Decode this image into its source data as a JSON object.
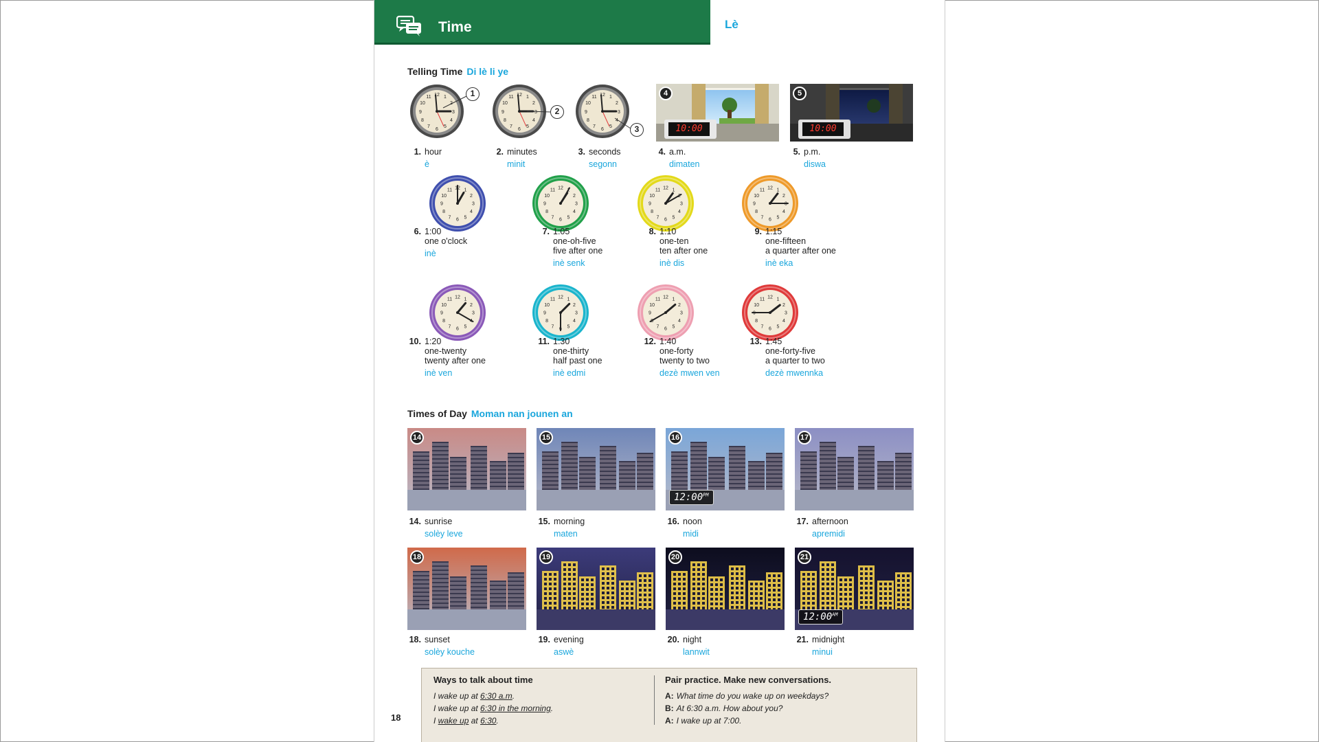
{
  "header": {
    "title": "Time",
    "translation": "Lè"
  },
  "telling_time": {
    "title": "Telling Time",
    "title_tr": "Di lè li ye",
    "items": [
      {
        "num": "1.",
        "en": "hour",
        "tr": "è"
      },
      {
        "num": "2.",
        "en": "minutes",
        "tr": "minit"
      },
      {
        "num": "3.",
        "en": "seconds",
        "tr": "segonn"
      },
      {
        "num": "4.",
        "en": "a.m.",
        "tr": "dimaten"
      },
      {
        "num": "5.",
        "en": "p.m.",
        "tr": "diswa"
      }
    ],
    "callouts": [
      "1",
      "2",
      "3",
      "4",
      "5"
    ],
    "digital": [
      "10:00",
      "10:00"
    ],
    "clocks": [
      {
        "num": "6.",
        "time": "1:00",
        "l1": "one o'clock",
        "l2": "",
        "tr": "inè",
        "color": "#3f4fae"
      },
      {
        "num": "7.",
        "time": "1:05",
        "l1": "one-oh-five",
        "l2": "five after one",
        "tr": "inè senk",
        "color": "#21a04a"
      },
      {
        "num": "8.",
        "time": "1:10",
        "l1": "one-ten",
        "l2": "ten after one",
        "tr": "inè dis",
        "color": "#e3d91a"
      },
      {
        "num": "9.",
        "time": "1:15",
        "l1": "one-fifteen",
        "l2": "a quarter after one",
        "tr": "inè eka",
        "color": "#ee9a2a"
      },
      {
        "num": "10.",
        "time": "1:20",
        "l1": "one-twenty",
        "l2": "twenty after one",
        "tr": "inè ven",
        "color": "#8a59b8"
      },
      {
        "num": "11.",
        "time": "1:30",
        "l1": "one-thirty",
        "l2": "half past one",
        "tr": "inè edmi",
        "color": "#1ab4cc"
      },
      {
        "num": "12.",
        "time": "1:40",
        "l1": "one-forty",
        "l2": "twenty to two",
        "tr": "dezè mwen ven",
        "color": "#ee9fb1"
      },
      {
        "num": "13.",
        "time": "1:45",
        "l1": "one-forty-five",
        "l2": "a quarter to two",
        "tr": "dezè mwennka",
        "color": "#df3a3a"
      }
    ]
  },
  "times_of_day": {
    "title": "Times of Day",
    "title_tr": "Moman nan jounen an",
    "items": [
      {
        "badge": "14",
        "num": "14.",
        "en": "sunrise",
        "tr": "solèy leve",
        "sky": "#c98a86"
      },
      {
        "badge": "15",
        "num": "15.",
        "en": "morning",
        "tr": "maten",
        "sky": "#6f86b8"
      },
      {
        "badge": "16",
        "num": "16.",
        "en": "noon",
        "tr": "midi",
        "sky": "#7aa6d8",
        "clock": "12:00",
        "suffix": "PM"
      },
      {
        "badge": "17",
        "num": "17.",
        "en": "afternoon",
        "tr": "apremidi",
        "sky": "#8c8fc4"
      },
      {
        "badge": "18",
        "num": "18.",
        "en": "sunset",
        "tr": "solèy kouche",
        "sky": "#d06a4a"
      },
      {
        "badge": "19",
        "num": "19.",
        "en": "evening",
        "tr": "aswè",
        "sky": "#3c3b7a"
      },
      {
        "badge": "20",
        "num": "20.",
        "en": "night",
        "tr": "lannwit",
        "sky": "#0d0d1e"
      },
      {
        "badge": "21",
        "num": "21.",
        "en": "midnight",
        "tr": "minui",
        "sky": "#15122e",
        "clock": "12:00",
        "suffix": "AM"
      }
    ]
  },
  "tips": {
    "left_title": "Ways to talk about time",
    "left_lines": [
      [
        "I wake up at ",
        "6:30 a.m",
        "."
      ],
      [
        "I wake up at ",
        "6:30",
        " in the morning",
        "."
      ],
      [
        "I ",
        "wake up",
        " at ",
        "6:30",
        "."
      ]
    ],
    "right_title": "Pair practice. Make new conversations.",
    "right_lines": [
      {
        "speaker": "A:",
        "text": "What time do you wake up on weekdays?"
      },
      {
        "speaker": "B:",
        "text": "At 6:30 a.m. How about you?"
      },
      {
        "speaker": "A:",
        "text": "I wake up at 7:00."
      }
    ]
  },
  "page_number": "18"
}
